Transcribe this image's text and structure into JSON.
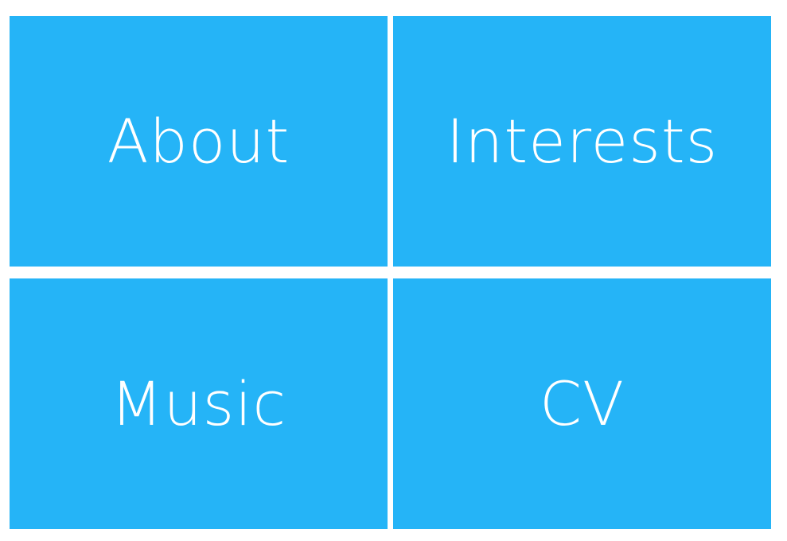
{
  "colors": {
    "tile_background": "#25b4f7",
    "tile_text": "#ffffff",
    "page_background": "#ffffff"
  },
  "menu": {
    "tiles": [
      {
        "label": "About"
      },
      {
        "label": "Interests"
      },
      {
        "label": "Music"
      },
      {
        "label": "CV"
      }
    ]
  }
}
